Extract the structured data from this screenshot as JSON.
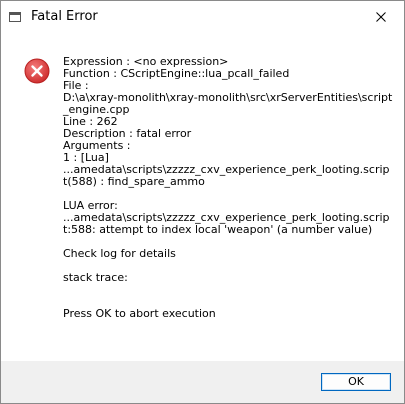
{
  "window": {
    "title": "Fatal Error",
    "close_icon": "close-icon",
    "app_icon": "application-icon"
  },
  "dialog": {
    "icon": "error-icon",
    "lines": [
      "Expression    : <no expression>",
      "Function      : CScriptEngine::lua_pcall_failed",
      "File          :",
      "D:\\a\\xray-monolith\\xray-monolith\\src\\xrServerEntities\\script_engine.cpp",
      "Line          : 262",
      "Description   : fatal error",
      "Arguments     :",
      " 1 : [Lua]",
      "...amedata\\scripts\\zzzzz_cxv_experience_perk_looting.script(588) : find_spare_ammo",
      "",
      "LUA error:",
      "...amedata\\scripts\\zzzzz_cxv_experience_perk_looting.script:588: attempt to index local 'weapon' (a number value)",
      "",
      "Check log for details",
      "",
      "stack trace:",
      "",
      "",
      "Press OK to abort execution"
    ]
  },
  "footer": {
    "ok_label": "OK"
  },
  "colors": {
    "error_red": "#e04343",
    "footer_bg": "#f0f0f0",
    "button_border": "#0067c0"
  }
}
